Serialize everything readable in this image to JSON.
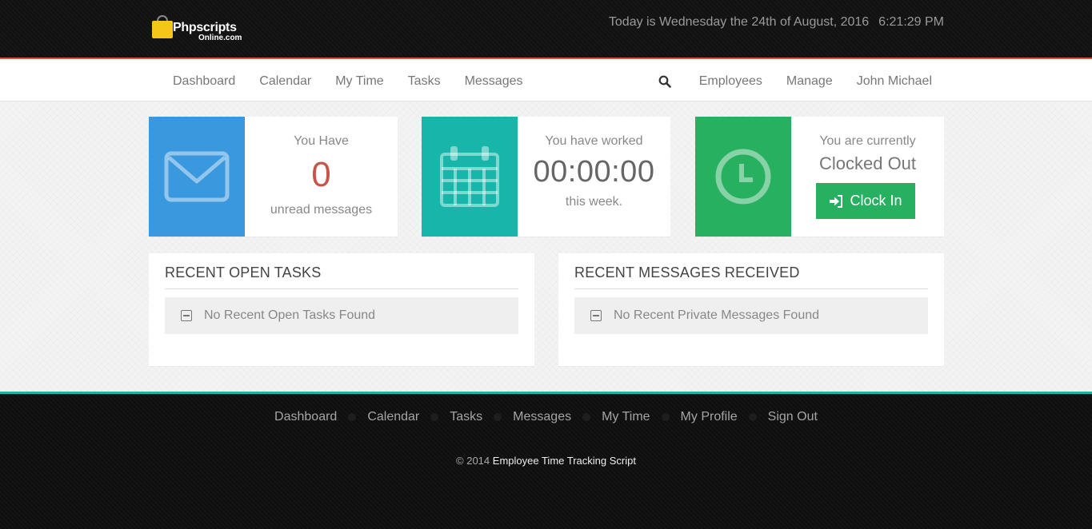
{
  "header": {
    "logo_main": "Phpscripts",
    "logo_sub": "Online.com",
    "date_text": "Today is Wednesday the 24th of August, 2016",
    "time_text": "6:21:29 PM"
  },
  "nav": {
    "left": [
      {
        "label": "Dashboard"
      },
      {
        "label": "Calendar"
      },
      {
        "label": "My Time"
      },
      {
        "label": "Tasks"
      },
      {
        "label": "Messages"
      }
    ],
    "right": [
      {
        "label": "Employees"
      },
      {
        "label": "Manage"
      },
      {
        "label": "John Michael"
      }
    ],
    "search_icon": "search-icon"
  },
  "cards": {
    "messages": {
      "icon": "envelope-icon",
      "color": "#3a98de",
      "top": "You Have",
      "count": "0",
      "bottom": "unread messages"
    },
    "worked": {
      "icon": "calendar-icon",
      "color": "#18b6aa",
      "top": "You have worked",
      "value": "00:00:00",
      "bottom": "this week."
    },
    "clock": {
      "icon": "clock-icon",
      "color": "#26b05f",
      "top": "You are currently",
      "status": "Clocked Out",
      "button_label": "Clock In",
      "button_icon": "sign-in-icon"
    }
  },
  "panels": {
    "tasks": {
      "title": "RECENT OPEN TASKS",
      "empty": "No Recent Open Tasks Found"
    },
    "messages": {
      "title": "RECENT MESSAGES RECEIVED",
      "empty": "No Recent Private Messages Found"
    }
  },
  "footer": {
    "links": [
      {
        "label": "Dashboard"
      },
      {
        "label": "Calendar"
      },
      {
        "label": "Tasks"
      },
      {
        "label": "Messages"
      },
      {
        "label": "My Time"
      },
      {
        "label": "My Profile"
      },
      {
        "label": "Sign Out"
      }
    ],
    "copyright_prefix": "© 2014",
    "copyright_brand": "Employee Time Tracking Script"
  },
  "colors": {
    "accent_red": "#e04b4b",
    "accent_teal": "#18b6aa",
    "count_red": "#c9544a"
  }
}
